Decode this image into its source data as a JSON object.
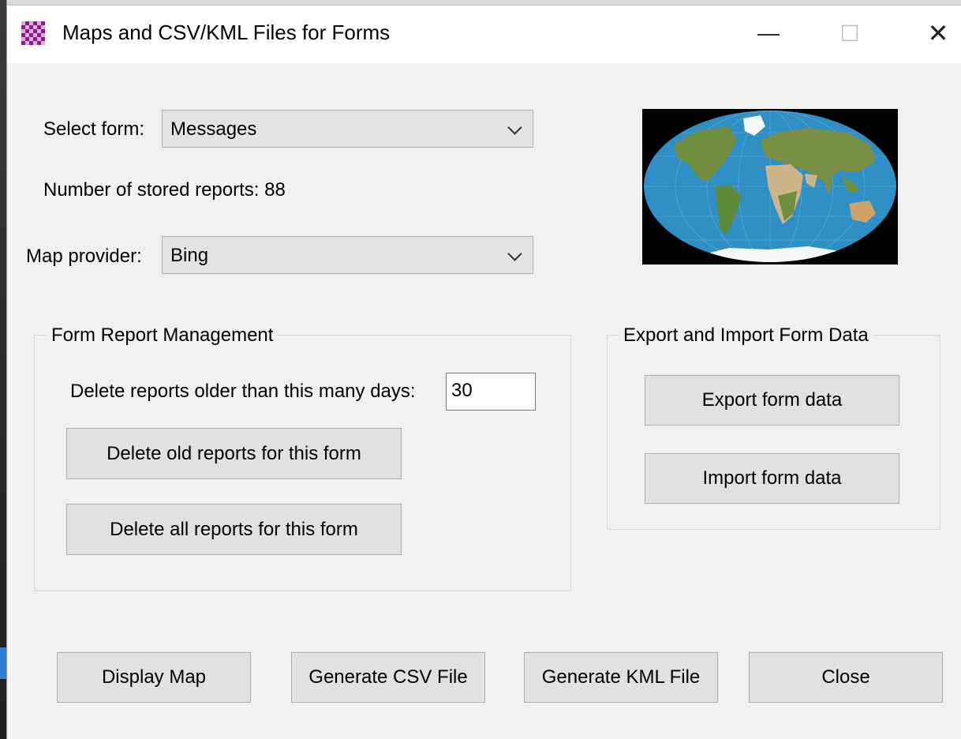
{
  "window": {
    "title": "Maps and CSV/KML Files for Forms",
    "minimize_glyph": "—",
    "maximize_glyph": "☐",
    "close_glyph": "✕"
  },
  "select_form": {
    "label": "Select form:",
    "value": "Messages"
  },
  "stored_reports": {
    "label": "Number of stored reports:",
    "count": "88"
  },
  "map_provider": {
    "label": "Map provider:",
    "value": "Bing"
  },
  "form_report_management": {
    "title": "Form Report Management",
    "days_label": "Delete reports older than this many days:",
    "days_value": "30",
    "delete_old_label": "Delete old reports for this form",
    "delete_all_label": "Delete all reports for this form"
  },
  "export_import": {
    "title": "Export and Import Form Data",
    "export_label": "Export form data",
    "import_label": "Import form data"
  },
  "bottom_buttons": {
    "display_map": "Display Map",
    "generate_csv": "Generate CSV File",
    "generate_kml": "Generate KML File",
    "close": "Close"
  },
  "colors": {
    "window_bg": "#f0f0f0",
    "button_bg": "#e1e1e1",
    "ocean": "#2f8fc4",
    "land": "#6f8f3f",
    "desert": "#cdb58a",
    "ice": "#f4f6f8",
    "icon_purple": "#8b1a8b"
  },
  "icons": {
    "app": "checkered-grid-icon",
    "map": "world-map-image"
  }
}
